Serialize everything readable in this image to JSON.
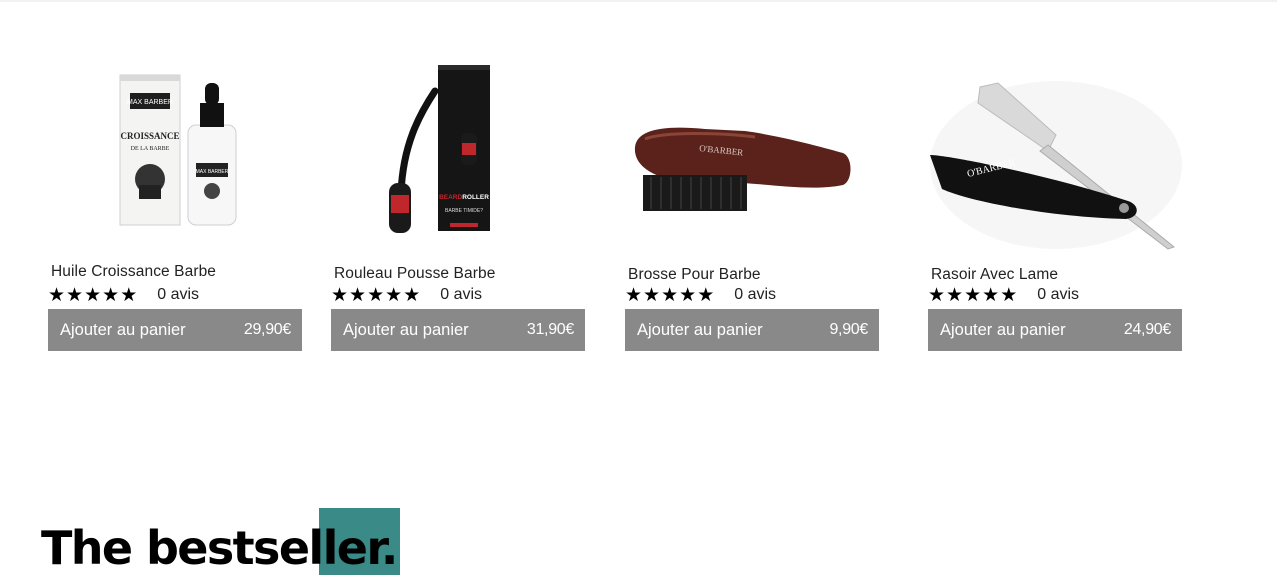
{
  "products": [
    {
      "name": "Huile Croissance Barbe",
      "reviews": "0 avis",
      "rating": 5,
      "cart_label": "Ajouter au panier",
      "price": "29,90€"
    },
    {
      "name": "Rouleau Pousse Barbe",
      "reviews": "0 avis",
      "rating": 5,
      "cart_label": "Ajouter au panier",
      "price": "31,90€"
    },
    {
      "name": "Brosse Pour Barbe",
      "reviews": "0 avis",
      "rating": 5,
      "cart_label": "Ajouter au panier",
      "price": "9,90€"
    },
    {
      "name": "Rasoir Avec Lame",
      "reviews": "0 avis",
      "rating": 5,
      "cart_label": "Ajouter au panier",
      "price": "24,90€"
    }
  ],
  "section": {
    "heading": "The bestseller."
  },
  "product_images": {
    "oil": {
      "box_brand": "MAX BARBER",
      "box_title": "CROISSANCE",
      "box_sub": "DE LA BARBE",
      "bottle_brand": "MAX BARBER"
    },
    "roller": {
      "box_brand_a": "BEARD",
      "box_brand_b": "ROLLER",
      "box_tagline": "BARBE TIMIDE?"
    },
    "brush": {
      "brand": "O'BARBER"
    },
    "razor": {
      "brand": "O'BARBER"
    }
  },
  "colors": {
    "button_bg": "#898989",
    "accent": "#3a8a88",
    "roller_red": "#c0272d",
    "brush_wood": "#5a221a"
  }
}
